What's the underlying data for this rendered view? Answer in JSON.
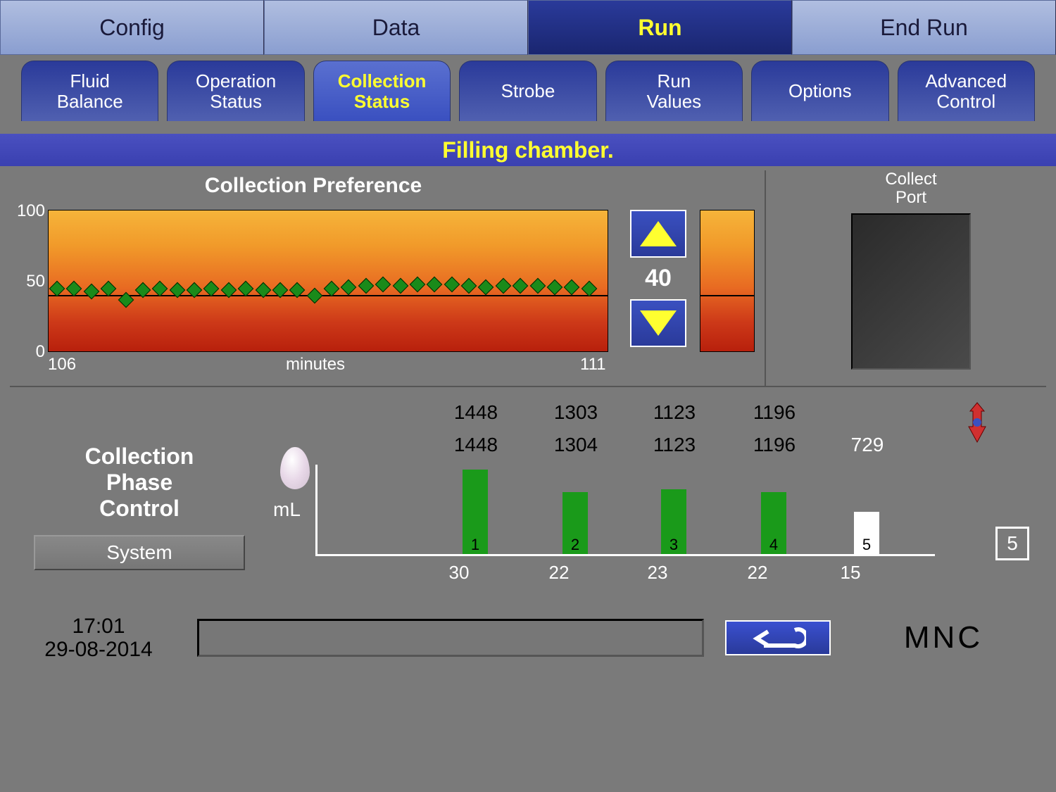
{
  "main_tabs": {
    "config": "Config",
    "data": "Data",
    "run": "Run",
    "end_run": "End Run"
  },
  "sub_tabs": {
    "fluid": "Fluid\nBalance",
    "operation": "Operation\nStatus",
    "collection": "Collection\nStatus",
    "strobe": "Strobe",
    "runvals": "Run\nValues",
    "options": "Options",
    "advanced": "Advanced\nControl"
  },
  "status_text": "Filling chamber.",
  "chart": {
    "title": "Collection Preference",
    "ymax": "100",
    "ymid": "50",
    "ymin": "0",
    "xmin": "106",
    "xmax": "111",
    "xlabel": "minutes"
  },
  "stepper_value": "40",
  "collect_port_label": "Collect\nPort",
  "phase": {
    "title": "Collection\nPhase\nControl",
    "system_btn": "System"
  },
  "ml_label": "mL",
  "bars": {
    "row1": [
      "1448",
      "1303",
      "1123",
      "1196"
    ],
    "row2": [
      "1448",
      "1304",
      "1123",
      "1196",
      "729"
    ],
    "labels": [
      "30",
      "22",
      "23",
      "22",
      "15"
    ],
    "nums": [
      "1",
      "2",
      "3",
      "4",
      "5"
    ]
  },
  "count_box": "5",
  "time": "17:01",
  "date": "29-08-2014",
  "mode": "MNC",
  "chart_data": {
    "type": "scatter",
    "title": "Collection Preference",
    "xlabel": "minutes",
    "ylabel": "",
    "xlim": [
      106,
      111
    ],
    "ylim": [
      0,
      100
    ],
    "threshold": 40,
    "series": [
      {
        "name": "preference",
        "y": [
          45,
          45,
          43,
          45,
          37,
          44,
          45,
          44,
          44,
          45,
          44,
          45,
          44,
          44,
          44,
          40,
          45,
          46,
          47,
          48,
          47,
          48,
          48,
          48,
          47,
          46,
          47,
          47,
          47,
          46,
          46,
          45
        ]
      }
    ],
    "bar_subchart": {
      "type": "bar",
      "categories": [
        "1",
        "2",
        "3",
        "4",
        "5"
      ],
      "values": [
        30,
        22,
        23,
        22,
        15
      ],
      "ylabel": "mL"
    }
  }
}
